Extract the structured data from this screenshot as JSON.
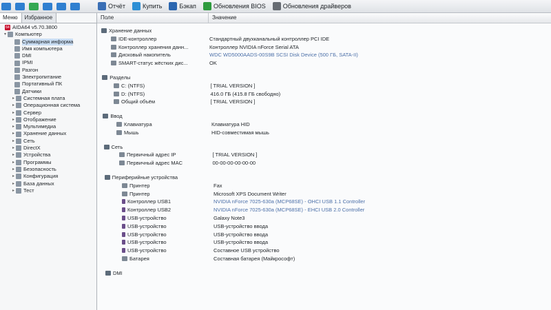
{
  "toolbar": {
    "buttons": [
      {
        "label": "Отчёт",
        "icon": "report-icon",
        "color": "#3a6fb5"
      },
      {
        "label": "Купить",
        "icon": "buy-icon",
        "color": "#2d8fd5"
      },
      {
        "label": "Бэкап",
        "icon": "backup-icon",
        "color": "#2a66b0"
      },
      {
        "label": "Обновления BIOS",
        "icon": "bios-update-icon",
        "color": "#2e9b3e"
      },
      {
        "label": "Обновления драйверов",
        "icon": "driver-update-icon",
        "color": "#666b72"
      }
    ]
  },
  "tabs": {
    "menu": "Меню",
    "favorites": "Избранное"
  },
  "tree": [
    {
      "label": "AIDA64 v5.70.3800",
      "icon": "aida64-icon",
      "expander": ""
    },
    {
      "label": "Компьютер",
      "icon": "computer-icon",
      "expander": "▾"
    },
    {
      "label": "Суммарная информа",
      "icon": "summary-icon",
      "expander": ""
    },
    {
      "label": "Имя компьютера",
      "icon": "computer-name-icon",
      "expander": ""
    },
    {
      "label": "DMI",
      "icon": "dmi-icon",
      "expander": ""
    },
    {
      "label": "IPMI",
      "icon": "ipmi-icon",
      "expander": ""
    },
    {
      "label": "Разгон",
      "icon": "overclock-icon",
      "expander": ""
    },
    {
      "label": "Электропитание",
      "icon": "power-icon",
      "expander": ""
    },
    {
      "label": "Портативный ПК",
      "icon": "laptop-icon",
      "expander": ""
    },
    {
      "label": "Датчики",
      "icon": "sensor-icon",
      "expander": ""
    },
    {
      "label": "Системная плата",
      "icon": "motherboard-icon",
      "expander": "▸"
    },
    {
      "label": "Операционная система",
      "icon": "os-icon",
      "expander": "▸"
    },
    {
      "label": "Сервер",
      "icon": "server-icon",
      "expander": "▸"
    },
    {
      "label": "Отображение",
      "icon": "display-icon",
      "expander": "▸"
    },
    {
      "label": "Мультимедиа",
      "icon": "multimedia-icon",
      "expander": "▸"
    },
    {
      "label": "Хранение данных",
      "icon": "storage-icon",
      "expander": "▸"
    },
    {
      "label": "Сеть",
      "icon": "network-icon",
      "expander": "▸"
    },
    {
      "label": "DirectX",
      "icon": "directx-icon",
      "expander": "▸"
    },
    {
      "label": "Устройства",
      "icon": "devices-icon",
      "expander": "▸"
    },
    {
      "label": "Программы",
      "icon": "programs-icon",
      "expander": "▸"
    },
    {
      "label": "Безопасность",
      "icon": "security-icon",
      "expander": "▸"
    },
    {
      "label": "Конфигурация",
      "icon": "config-icon",
      "expander": "▸"
    },
    {
      "label": "База данных",
      "icon": "database-icon",
      "expander": "▸"
    },
    {
      "label": "Тест",
      "icon": "benchmark-icon",
      "expander": "▸"
    }
  ],
  "columns": {
    "field": "Поле",
    "value": "Значение"
  },
  "sections": [
    {
      "title": "Хранение данных",
      "icon": "storage-section-icon",
      "rows": [
        {
          "field": "IDE-контроллер",
          "value": "Стандартный двухканальный контроллер PCI IDE",
          "link": false
        },
        {
          "field": "Контроллер хранения данн...",
          "value": "Контроллер NVIDIA nForce Serial ATA",
          "link": false
        },
        {
          "field": "Дисковый накопитель",
          "value": "WDC WD5000AADS-00S9B SCSI Disk Device (500 ГБ, SATA-II)",
          "link": true
        },
        {
          "field": "SMART-статус жёстких дис...",
          "value": "OK",
          "link": false
        }
      ]
    },
    {
      "title": "Разделы",
      "icon": "partitions-section-icon",
      "rows": [
        {
          "field": "C: (NTFS)",
          "value": "[ TRIAL VERSION ]",
          "link": false
        },
        {
          "field": "D: (NTFS)",
          "value": "416.0 ГБ (415.8 ГБ свободно)",
          "link": false
        },
        {
          "field": "Общий объём",
          "value": "[ TRIAL VERSION ]",
          "link": false
        }
      ]
    },
    {
      "title": "Ввод",
      "icon": "input-section-icon",
      "rows": [
        {
          "field": "Клавиатура",
          "value": "Клавиатура HID",
          "link": false
        },
        {
          "field": "Мышь",
          "value": "HID-совместимая мышь",
          "link": false
        }
      ]
    },
    {
      "title": "Сеть",
      "icon": "network-section-icon",
      "rows": [
        {
          "field": "Первичный адрес IP",
          "value": "[ TRIAL VERSION ]",
          "link": false
        },
        {
          "field": "Первичный адрес MAC",
          "value": "00-00-00-00-00-00",
          "link": false
        }
      ]
    },
    {
      "title": "Периферийные устройства",
      "icon": "peripherals-section-icon",
      "rows": [
        {
          "field": "Принтер",
          "value": "Fax",
          "link": false
        },
        {
          "field": "Принтер",
          "value": "Microsoft XPS Document Writer",
          "link": false
        },
        {
          "field": "Контроллер USB1",
          "value": "NVIDIA nForce 7025-630a (MCP68SE) - OHCI USB 1.1 Controller",
          "link": true
        },
        {
          "field": "Контроллер USB2",
          "value": "NVIDIA nForce 7025-630a (MCP68SE) - EHCI USB 2.0 Controller",
          "link": true
        },
        {
          "field": "USB-устройство",
          "value": "Galaxy Note3",
          "link": false
        },
        {
          "field": "USB-устройство",
          "value": "USB-устройство ввода",
          "link": false
        },
        {
          "field": "USB-устройство",
          "value": "USB-устройство ввода",
          "link": false
        },
        {
          "field": "USB-устройство",
          "value": "USB-устройство ввода",
          "link": false
        },
        {
          "field": "USB-устройство",
          "value": "Составное USB устройство",
          "link": false
        },
        {
          "field": "Батарея",
          "value": "Составная батарея (Майкрософт)",
          "link": false
        }
      ]
    },
    {
      "title": "DMI",
      "icon": "dmi-section-icon",
      "rows": []
    }
  ]
}
